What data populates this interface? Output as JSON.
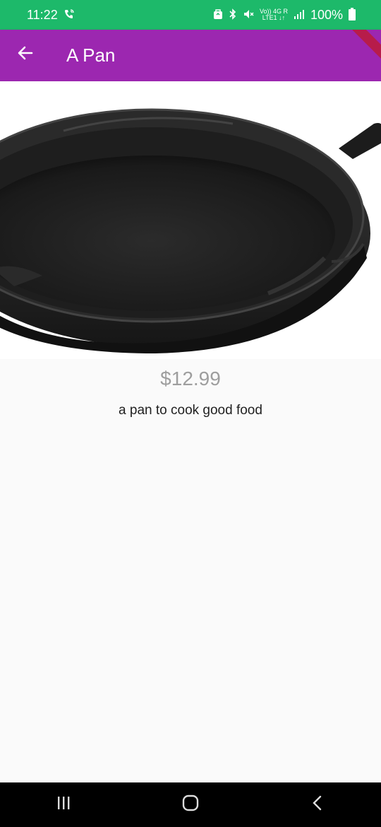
{
  "status_bar": {
    "time": "11:22",
    "call_icon": "wifi-call-icon",
    "battery_text": "100%",
    "network_line1": "Vo)) 4G R",
    "network_line2": "LTE1 ↓↑"
  },
  "app_bar": {
    "title": "A Pan",
    "back_icon": "arrow-left-icon",
    "color": "#9c27b0"
  },
  "product": {
    "image_icon": "frying-pan-image",
    "price": "$12.99",
    "description": "a pan to cook good food"
  },
  "nav_bar": {
    "recents_icon": "recents-icon",
    "home_icon": "home-icon",
    "back_icon": "back-chevron-icon"
  }
}
